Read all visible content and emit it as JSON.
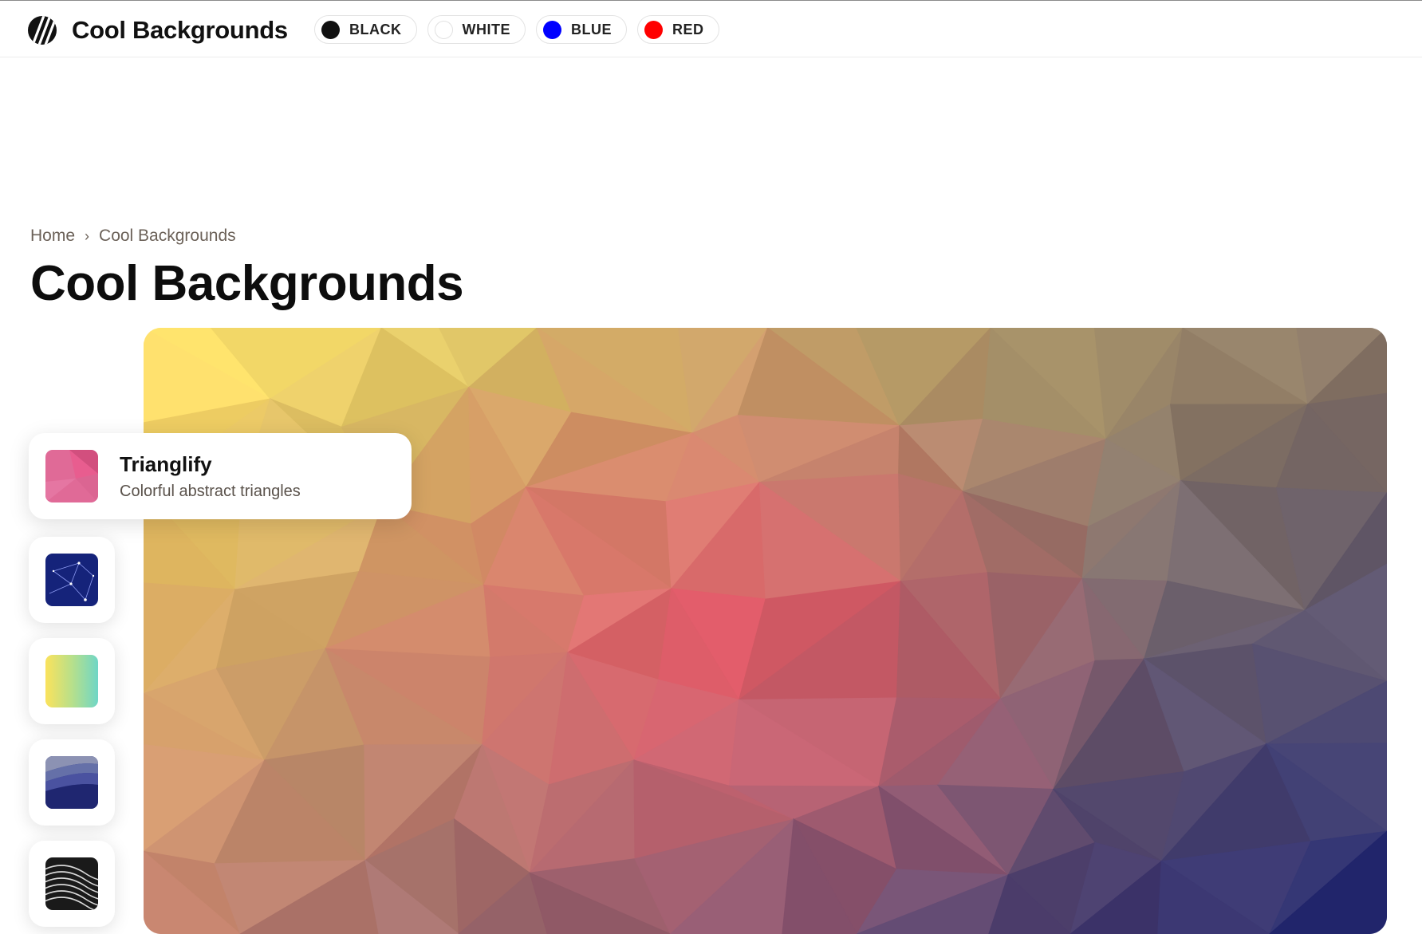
{
  "header": {
    "brand": "Cool Backgrounds",
    "color_filters": [
      {
        "label": "BLACK",
        "color": "#111111"
      },
      {
        "label": "WHITE",
        "color": "#ffffff"
      },
      {
        "label": "BLUE",
        "color": "#0000ff"
      },
      {
        "label": "RED",
        "color": "#ff0000"
      }
    ]
  },
  "breadcrumb": {
    "home": "Home",
    "separator": "›",
    "current": "Cool Backgrounds"
  },
  "page_title": "Cool Backgrounds",
  "generators": [
    {
      "title": "Trianglify",
      "subtitle": "Colorful abstract triangles",
      "active": true,
      "icon": "trianglify-thumbnail"
    },
    {
      "icon": "particles-thumbnail"
    },
    {
      "icon": "gradient-thumbnail"
    },
    {
      "icon": "layered-waves-thumbnail"
    },
    {
      "icon": "halftone-thumbnail"
    }
  ],
  "colors": {
    "hero_top_left": "#ffe564",
    "hero_center": "#ff4f6d",
    "hero_top_right": "#8e7a68",
    "hero_bottom_right": "#1c2472"
  }
}
